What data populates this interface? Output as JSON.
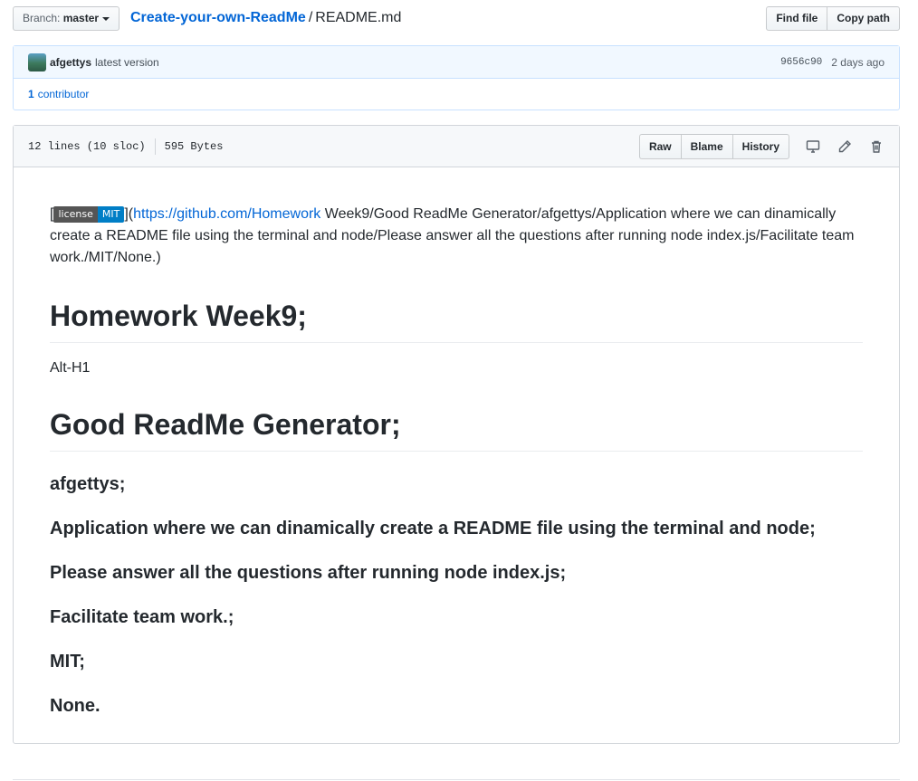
{
  "branch": {
    "prefix": "Branch:",
    "name": "master"
  },
  "breadcrumb": {
    "repo": "Create-your-own-ReadMe",
    "separator": "/",
    "file": "README.md"
  },
  "file_nav": {
    "find_file": "Find file",
    "copy_path": "Copy path"
  },
  "commit": {
    "author": "afgettys",
    "message": "latest version",
    "sha": "9656c90",
    "time": "2 days ago",
    "contributors_count": "1",
    "contributors_label": "contributor"
  },
  "file_header": {
    "lines": "12 lines (10 sloc)",
    "size": "595 Bytes",
    "raw": "Raw",
    "blame": "Blame",
    "history": "History",
    "icons": [
      "desktop-icon",
      "pencil-icon",
      "trash-icon"
    ]
  },
  "readme": {
    "badge": {
      "left": "license",
      "right": "MIT",
      "left_color": "#555555",
      "right_color": "#007ec6"
    },
    "para_open_bracket": "[",
    "para_close_paren_open": "](",
    "para_link": "https://github.com/Homework",
    "para_rest": " Week9/Good ReadMe Generator/afgettys/Application where we can dinamically create a README file using the terminal and node/Please answer all the questions after running node index.js/Facilitate team work./MIT/None.)",
    "h1_first": "Homework Week9;",
    "alt_text": "Alt-H1",
    "h1_second": "Good ReadMe Generator;",
    "h3_items": [
      "afgettys;",
      "Application where we can dinamically create a README file using the terminal and node;",
      "Please answer all the questions after running node index.js;",
      "Facilitate team work.;",
      "MIT;",
      "None."
    ]
  },
  "colors": {
    "link": "#0366d6",
    "commit_bg": "#f1f8ff",
    "header_bg": "#f6f8fa"
  }
}
